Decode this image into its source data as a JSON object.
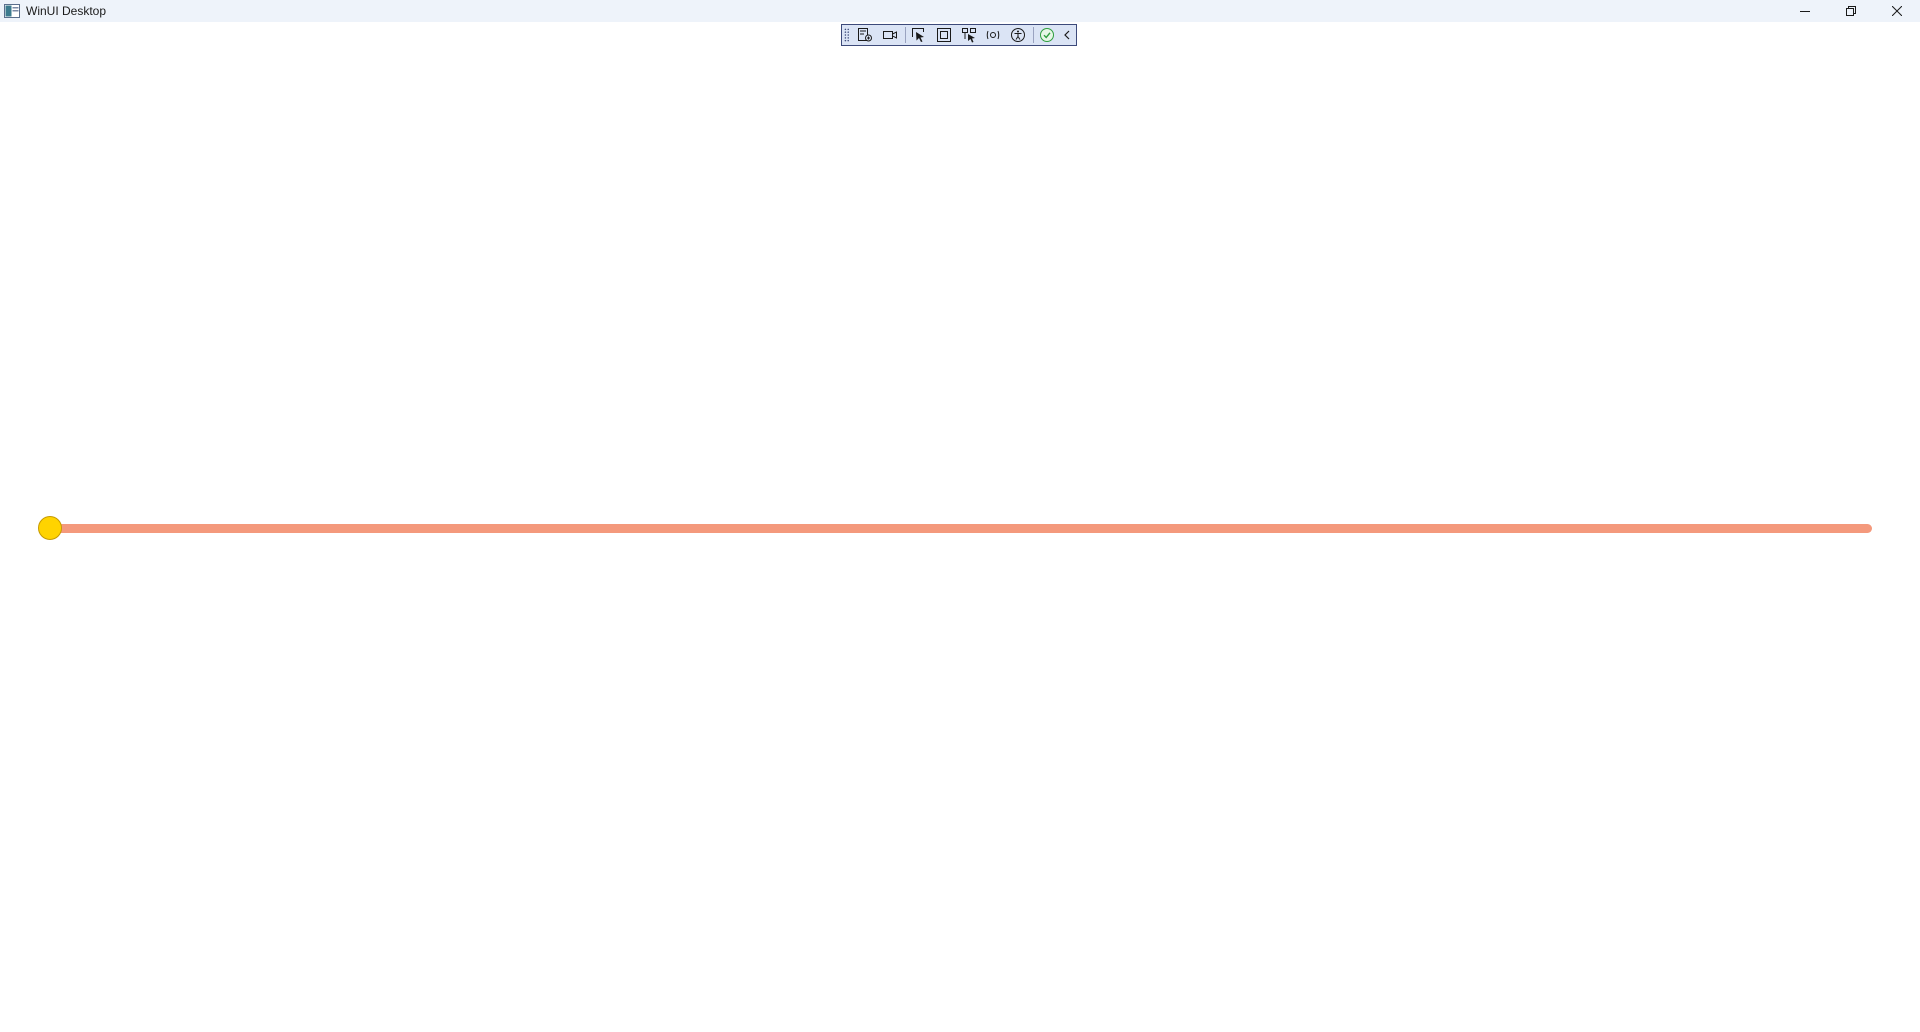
{
  "window": {
    "title": "WinUI Desktop",
    "app_icon": "window-app-icon"
  },
  "caption": {
    "minimize_icon": "minimize-icon",
    "restore_icon": "restore-icon",
    "close_icon": "close-icon"
  },
  "debug_toolbar": {
    "tools": [
      "go-to-live-visual-tree-icon",
      "show-in-app-toolbar-video-icon",
      "select-element-icon",
      "display-layout-adorners-icon",
      "track-focus-icon",
      "hot-reload-icon",
      "accessibility-checker-icon",
      "ok-status-icon",
      "collapse-chevron-icon"
    ]
  },
  "slider": {
    "value_fraction": 0.0,
    "track_color": "#f4997c",
    "thumb_color": "#ffd300"
  }
}
